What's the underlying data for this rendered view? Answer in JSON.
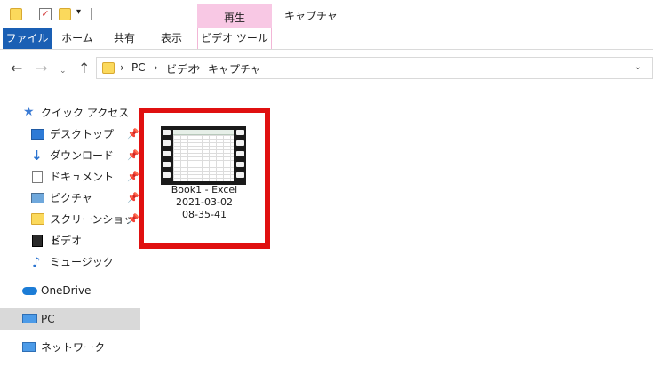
{
  "window": {
    "context_group": "再生",
    "title": "キャプチャ"
  },
  "quick_access_toolbar": {
    "icons": [
      "folder-icon",
      "properties-check-icon",
      "new-folder-icon",
      "customize-dropdown-icon"
    ]
  },
  "ribbon": {
    "tabs": [
      {
        "label": "ファイル",
        "active": true
      },
      {
        "label": "ホーム"
      },
      {
        "label": "共有"
      },
      {
        "label": "表示"
      },
      {
        "label": "ビデオ ツール"
      }
    ],
    "colors": {
      "file_tab": "#1a5fb4",
      "context_group": "#f8c8e4"
    }
  },
  "address_bar": {
    "breadcrumbs": [
      "PC",
      "ビデオ",
      "キャプチャ"
    ]
  },
  "sidebar": {
    "quick_access": {
      "label": "クイック アクセス",
      "items": [
        {
          "label": "デスクトップ",
          "icon": "desktop-icon",
          "pinned": true
        },
        {
          "label": "ダウンロード",
          "icon": "download-icon",
          "pinned": true
        },
        {
          "label": "ドキュメント",
          "icon": "document-icon",
          "pinned": true
        },
        {
          "label": "ピクチャ",
          "icon": "pictures-icon",
          "pinned": true
        },
        {
          "label": "スクリーンショット",
          "icon": "folder-icon",
          "pinned": true
        },
        {
          "label": "ビデオ",
          "icon": "video-icon",
          "pinned": false
        },
        {
          "label": "ミュージック",
          "icon": "music-icon",
          "pinned": false
        }
      ]
    },
    "onedrive": {
      "label": "OneDrive"
    },
    "pc": {
      "label": "PC",
      "selected": true
    },
    "network": {
      "label": "ネットワーク"
    }
  },
  "content": {
    "files": [
      {
        "name_lines": [
          "Book1 - Excel",
          "2021-03-02",
          "08-35-41"
        ],
        "icon": "video-thumbnail-icon",
        "highlighted": true,
        "highlight_color": "#e01010"
      }
    ]
  }
}
